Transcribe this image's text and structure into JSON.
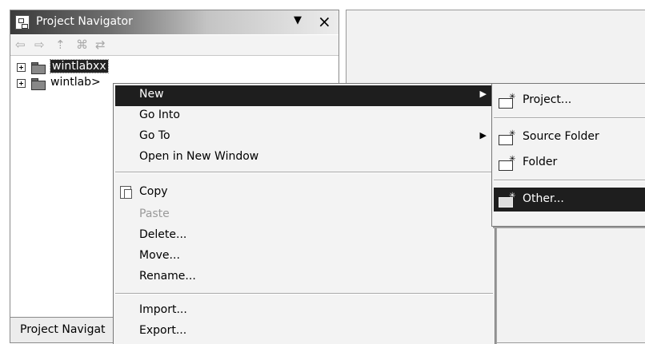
{
  "navigator": {
    "title": "Project Navigator",
    "menu_glyph": "▼",
    "close_glyph": "×",
    "toolbar": {
      "back_glyph": "⇦",
      "forward_glyph": "⇨",
      "up_glyph": "⇡",
      "collapse_glyph": "⌘",
      "link_glyph": "⇄"
    },
    "tree": [
      {
        "label": "wintlabxx",
        "selected": true,
        "icon": "project-folder-icon"
      },
      {
        "label": "wintlab>",
        "selected": false,
        "icon": "project-folder-icon"
      }
    ],
    "bottom_tab": "Project Navigat"
  },
  "context_menu": {
    "new": "New",
    "go_into": "Go Into",
    "go_to": "Go To",
    "open_new_window": "Open in New Window",
    "copy": "Copy",
    "paste": "Paste",
    "delete": "Delete...",
    "move": "Move...",
    "rename": "Rename...",
    "import": "Import...",
    "export": "Export...",
    "submenu_arrow": "▶"
  },
  "submenu": {
    "project": "Project...",
    "source_folder": "Source Folder",
    "folder": "Folder",
    "other": "Other..."
  },
  "colors": {
    "selection": "#1e1e1e",
    "menu_background": "#f3f3f3",
    "disabled_text": "#9a9a9a"
  }
}
